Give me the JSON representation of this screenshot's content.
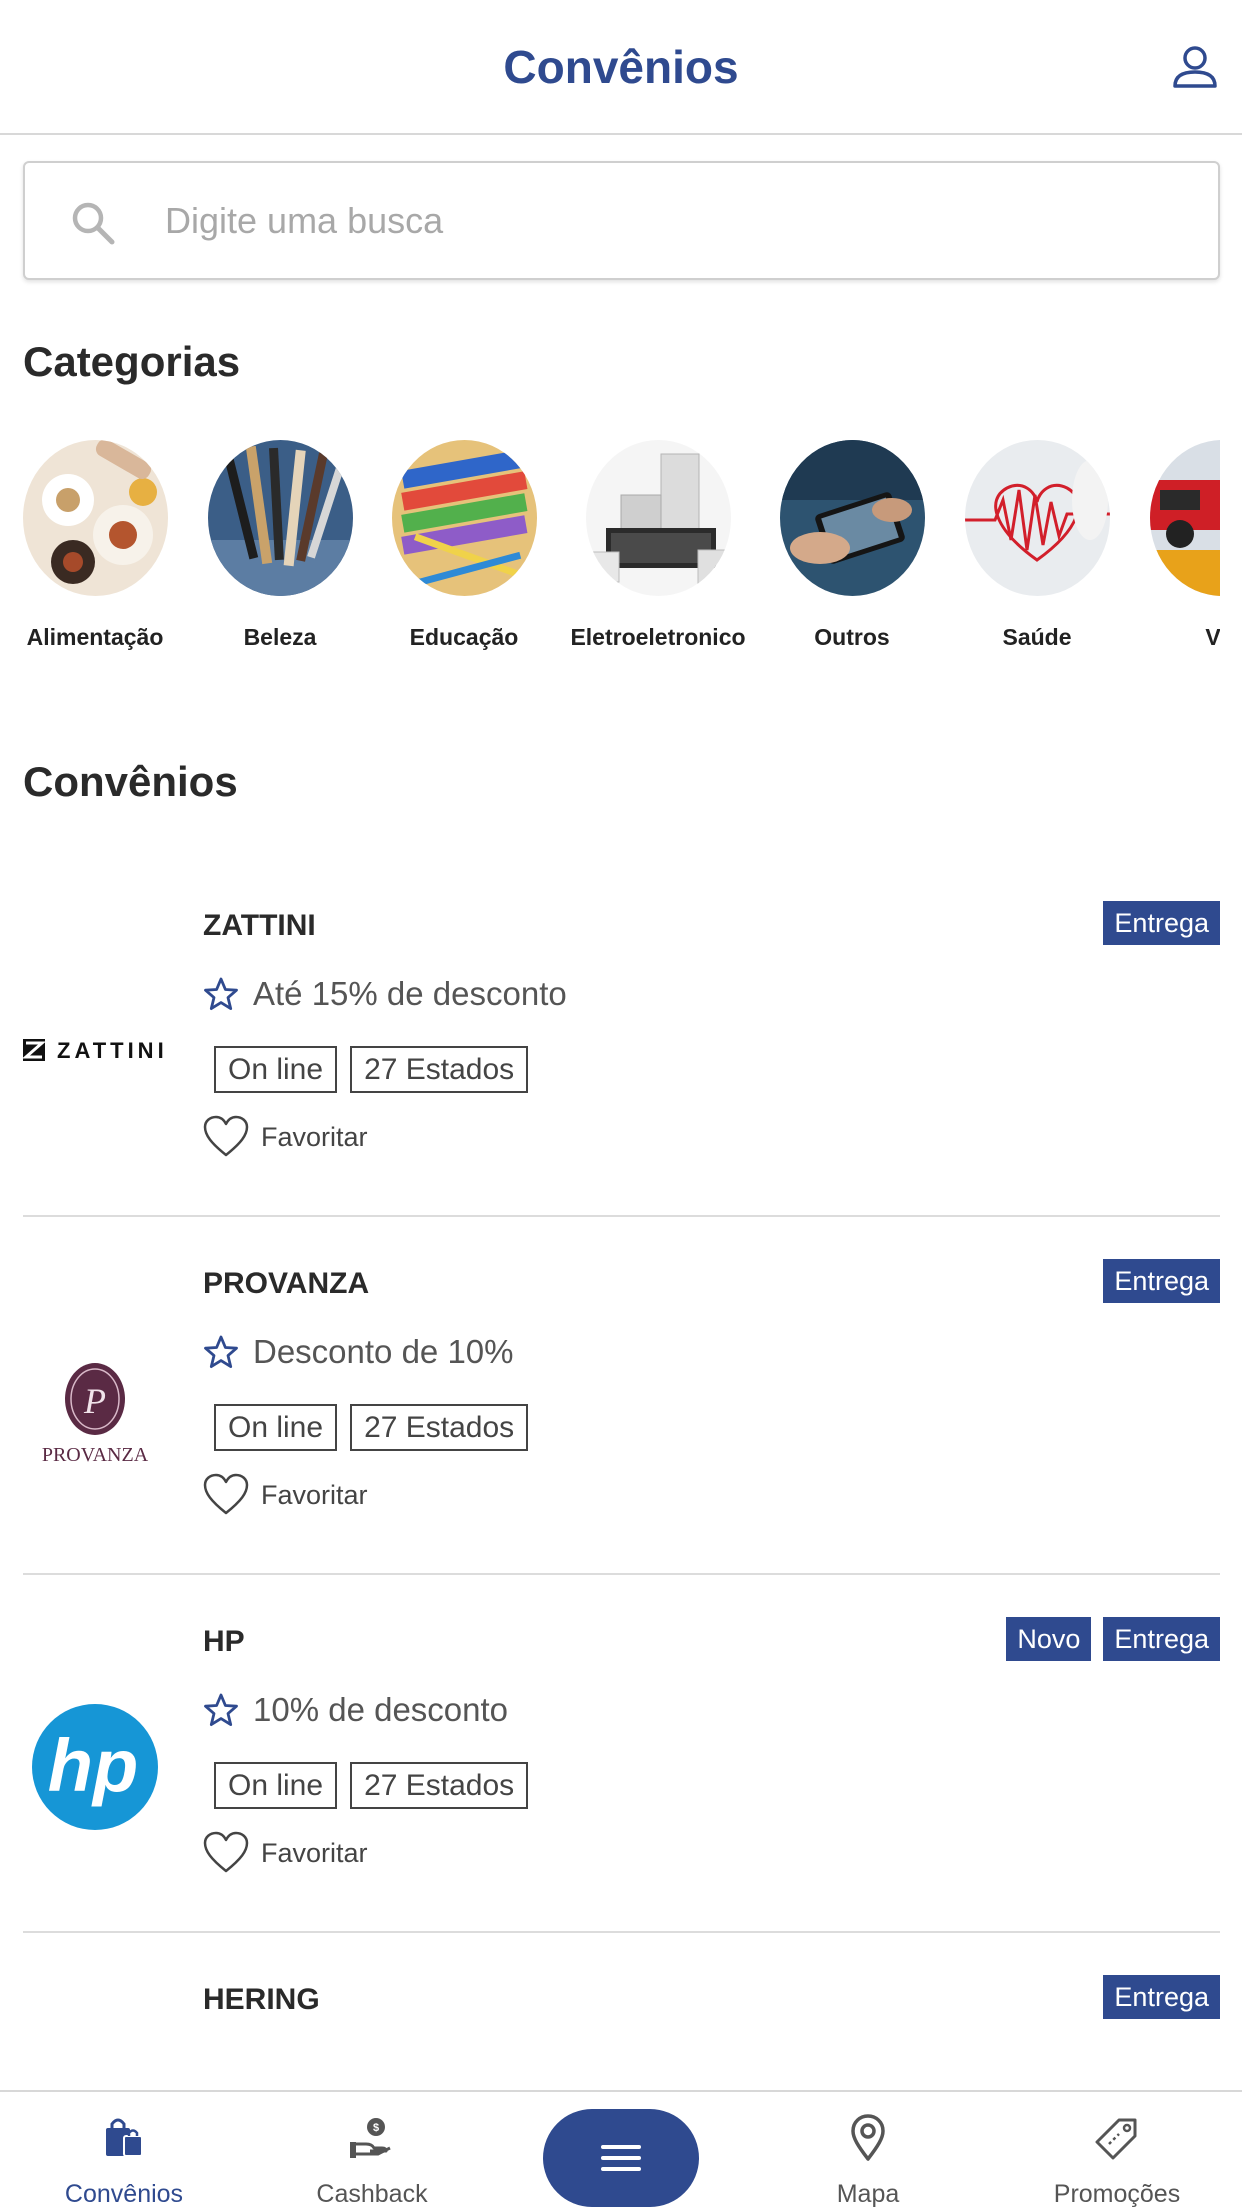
{
  "header": {
    "title": "Convênios"
  },
  "search": {
    "placeholder": "Digite uma busca"
  },
  "categories": {
    "title": "Categorias",
    "items": [
      {
        "label": "Alimentação"
      },
      {
        "label": "Beleza"
      },
      {
        "label": "Educação"
      },
      {
        "label": "Eletroeletronico"
      },
      {
        "label": "Outros"
      },
      {
        "label": "Saúde"
      },
      {
        "label": "Veí"
      }
    ]
  },
  "convenios": {
    "title": "Convênios",
    "items": [
      {
        "name": "ZATTINI",
        "badges": [
          "Entrega"
        ],
        "discount": "Até 15% de desconto",
        "tags": [
          "On line",
          "27 Estados"
        ],
        "favorite_label": "Favoritar",
        "logo_text": "ZATTINI"
      },
      {
        "name": "PROVANZA",
        "badges": [
          "Entrega"
        ],
        "discount": "Desconto de 10%",
        "tags": [
          "On line",
          "27 Estados"
        ],
        "favorite_label": "Favoritar",
        "logo_text": "PROVANZA"
      },
      {
        "name": "HP",
        "badges": [
          "Novo",
          "Entrega"
        ],
        "discount": "10% de desconto",
        "tags": [
          "On line",
          "27 Estados"
        ],
        "favorite_label": "Favoritar",
        "logo_text": "hp"
      },
      {
        "name": "HERING",
        "badges": [
          "Entrega"
        ]
      }
    ]
  },
  "bottom_nav": {
    "items": [
      {
        "label": "Convênios",
        "icon": "shopping-bags-icon",
        "active": true
      },
      {
        "label": "Cashback",
        "icon": "hand-coin-icon"
      },
      {
        "label": "Mapa",
        "icon": "map-pin-icon"
      },
      {
        "label": "Promoções",
        "icon": "price-tag-icon"
      }
    ],
    "center_icon": "menu-icon"
  },
  "colors": {
    "brand": "#2f4a8f",
    "divider": "#d8d8d8"
  }
}
